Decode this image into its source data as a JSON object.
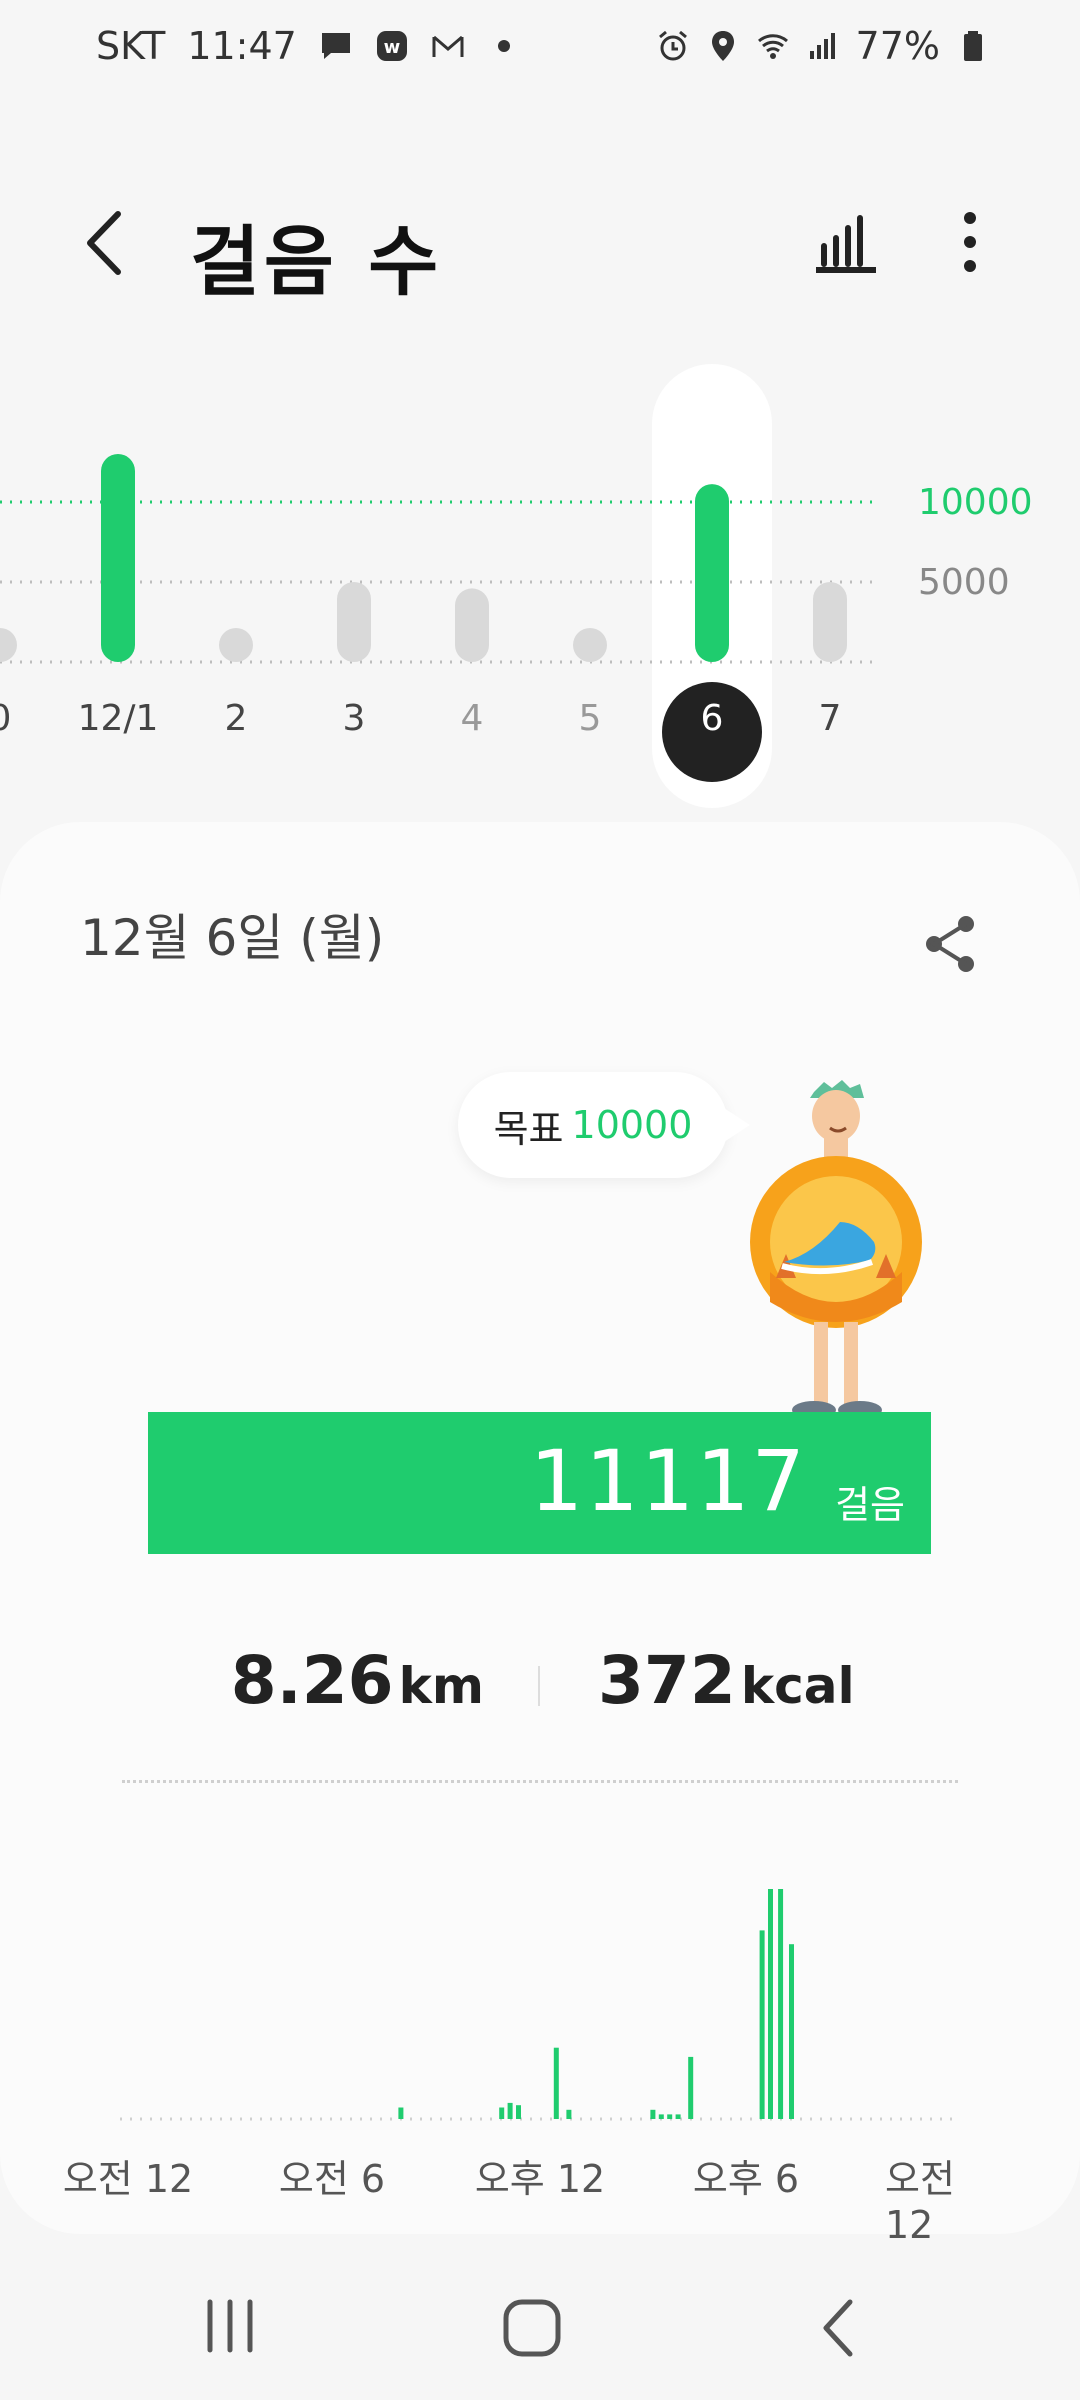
{
  "status_bar": {
    "carrier": "SKT",
    "time": "11:47",
    "battery": "77%",
    "icons": [
      "message-icon",
      "w-app-icon",
      "gmail-icon",
      "dot-icon",
      "alarm-icon",
      "location-icon",
      "wifi-icon",
      "signal-icon",
      "battery-icon"
    ]
  },
  "header": {
    "title": "걸음 수",
    "back_icon": "back-arrow-icon",
    "chart_icon": "bar-chart-icon",
    "more_icon": "more-vertical-icon"
  },
  "week_chart": {
    "goal_label": "10000",
    "mid_label": "5000",
    "days": [
      {
        "label": "0",
        "steps": 300,
        "dim": false
      },
      {
        "label": "12/1",
        "steps": 13000,
        "dim": false
      },
      {
        "label": "2",
        "steps": 300,
        "dim": false
      },
      {
        "label": "3",
        "steps": 5000,
        "dim": false
      },
      {
        "label": "4",
        "steps": 4600,
        "dim": true
      },
      {
        "label": "5",
        "steps": 300,
        "dim": true
      },
      {
        "label": "6",
        "steps": 11117,
        "dim": false,
        "selected": true
      },
      {
        "label": "7",
        "steps": 5000,
        "dim": false
      }
    ]
  },
  "card": {
    "date": "12월 6일 (월)",
    "share_icon": "share-icon",
    "goal_prefix": "목표",
    "goal_value": "10000",
    "steps": "11117",
    "steps_unit": "걸음",
    "distance": "8.26",
    "distance_unit": "km",
    "calories": "372",
    "calories_unit": "kcal"
  },
  "hourly": {
    "time_labels": [
      "오전 12",
      "오전 6",
      "오후 12",
      "오후 6",
      "오전 12"
    ],
    "bars": [
      {
        "t": 0.335,
        "v": 0.05
      },
      {
        "t": 0.455,
        "v": 0.05
      },
      {
        "t": 0.465,
        "v": 0.07
      },
      {
        "t": 0.475,
        "v": 0.06
      },
      {
        "t": 0.52,
        "v": 0.31
      },
      {
        "t": 0.535,
        "v": 0.04
      },
      {
        "t": 0.635,
        "v": 0.04
      },
      {
        "t": 0.645,
        "v": 0.02
      },
      {
        "t": 0.655,
        "v": 0.02
      },
      {
        "t": 0.665,
        "v": 0.02
      },
      {
        "t": 0.68,
        "v": 0.27
      },
      {
        "t": 0.765,
        "v": 0.82
      },
      {
        "t": 0.775,
        "v": 1.0
      },
      {
        "t": 0.787,
        "v": 1.0
      },
      {
        "t": 0.8,
        "v": 0.76
      }
    ]
  },
  "colors": {
    "accent": "#1fcc6e",
    "inactive": "#d9d9d9",
    "selected_circle": "#222222"
  }
}
